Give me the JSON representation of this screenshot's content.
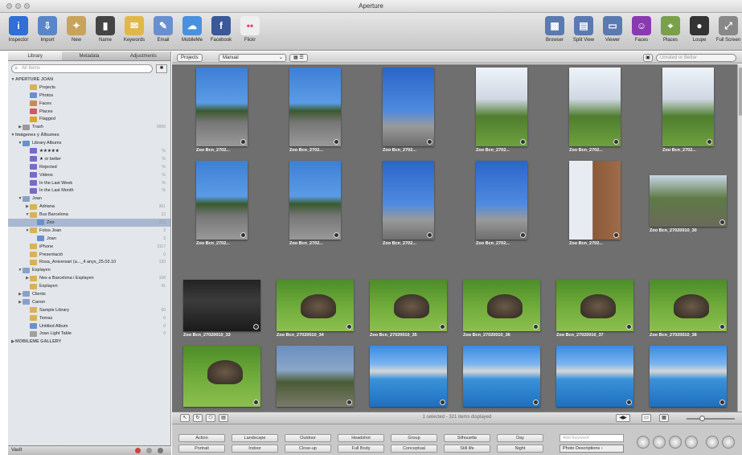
{
  "window": {
    "title": "Aperture"
  },
  "toolbar": {
    "left": [
      {
        "label": "Inspector",
        "icon": "info-icon",
        "color": "#2f6fd6",
        "glyph": "i"
      },
      {
        "label": "Import",
        "icon": "import-arrow-icon",
        "color": "#5a86c8",
        "glyph": "⇩"
      },
      {
        "label": "New",
        "icon": "new-project-icon",
        "color": "#c8a45a",
        "glyph": "✦"
      },
      {
        "label": "Name",
        "icon": "name-stamp-icon",
        "color": "#444444",
        "glyph": "▮"
      },
      {
        "label": "Keywords",
        "icon": "keywords-tag-icon",
        "color": "#e0b84a",
        "glyph": "✉"
      },
      {
        "label": "Email",
        "icon": "email-icon",
        "color": "#6a8fd0",
        "glyph": "✎"
      },
      {
        "label": "MobileMe",
        "icon": "mobileme-cloud-icon",
        "color": "#4a90e0",
        "glyph": "☁"
      },
      {
        "label": "Facebook",
        "icon": "facebook-icon",
        "color": "#3b5998",
        "glyph": "f"
      },
      {
        "label": "Flickr",
        "icon": "flickr-icon",
        "color": "#eeeeee",
        "glyph": "••"
      }
    ],
    "right": [
      {
        "label": "Browser",
        "icon": "browser-view-icon",
        "color": "#5a7ab0",
        "glyph": "▦"
      },
      {
        "label": "Split View",
        "icon": "split-view-icon",
        "color": "#5a7ab0",
        "glyph": "▤"
      },
      {
        "label": "Viewer",
        "icon": "viewer-icon",
        "color": "#5a7ab0",
        "glyph": "▭"
      },
      {
        "label": "Faces",
        "icon": "faces-icon",
        "color": "#8a3ab0",
        "glyph": "☺"
      },
      {
        "label": "Places",
        "icon": "places-icon",
        "color": "#7aa04a",
        "glyph": "⌖"
      },
      {
        "label": "Loupe",
        "icon": "loupe-icon",
        "color": "#333333",
        "glyph": "●"
      },
      {
        "label": "Full Screen",
        "icon": "full-screen-icon",
        "color": "#888888",
        "glyph": "⤢"
      }
    ]
  },
  "sidebar": {
    "tabs": [
      {
        "label": "Library",
        "active": true
      },
      {
        "label": "Metadata",
        "active": false
      },
      {
        "label": "Adjustments",
        "active": false
      }
    ],
    "search_placeholder": "All Items",
    "tree": [
      {
        "label": "APERTURE JOAN",
        "level": 0,
        "kind": "section",
        "tri": "▼",
        "color": "",
        "count": ""
      },
      {
        "label": "Projects",
        "level": 2,
        "kind": "item",
        "tri": "",
        "color": "#d9b15a",
        "count": ""
      },
      {
        "label": "Photos",
        "level": 2,
        "kind": "item",
        "tri": "",
        "color": "#6a8fd0",
        "count": ""
      },
      {
        "label": "Faces",
        "level": 2,
        "kind": "item",
        "tri": "",
        "color": "#c88a5a",
        "count": ""
      },
      {
        "label": "Places",
        "level": 2,
        "kind": "item",
        "tri": "",
        "color": "#d05a5a",
        "count": ""
      },
      {
        "label": "Flagged",
        "level": 2,
        "kind": "item",
        "tri": "",
        "color": "#e0a030",
        "count": ""
      },
      {
        "label": "Trash",
        "level": 1,
        "kind": "item",
        "tri": "▶",
        "color": "#9a9a9a",
        "count": "0000"
      },
      {
        "label": "Imágenes y Álbumes",
        "level": 0,
        "kind": "section",
        "tri": "▼",
        "color": "",
        "count": ""
      },
      {
        "label": "Library Albums",
        "level": 1,
        "kind": "item",
        "tri": "▼",
        "color": "#6a8fd0",
        "count": ""
      },
      {
        "label": "★★★★★",
        "level": 2,
        "kind": "item",
        "tri": "",
        "color": "#7a6ac8",
        "count": "%"
      },
      {
        "label": "★ or better",
        "level": 2,
        "kind": "item",
        "tri": "",
        "color": "#7a6ac8",
        "count": "%"
      },
      {
        "label": "Rejected",
        "level": 2,
        "kind": "item",
        "tri": "",
        "color": "#7a6ac8",
        "count": "%"
      },
      {
        "label": "Videos",
        "level": 2,
        "kind": "item",
        "tri": "",
        "color": "#7a6ac8",
        "count": "%"
      },
      {
        "label": "In the Last Week",
        "level": 2,
        "kind": "item",
        "tri": "",
        "color": "#7a6ac8",
        "count": "%"
      },
      {
        "label": "In the Last Month",
        "level": 2,
        "kind": "item",
        "tri": "",
        "color": "#7a6ac8",
        "count": "%"
      },
      {
        "label": "Joan",
        "level": 1,
        "kind": "item",
        "tri": "▼",
        "color": "#8aa0c8",
        "count": ""
      },
      {
        "label": "Adriana",
        "level": 2,
        "kind": "item",
        "tri": "▶",
        "color": "#d9b15a",
        "count": "361"
      },
      {
        "label": "Bus Barcelona",
        "level": 2,
        "kind": "item",
        "tri": "▼",
        "color": "#d9b15a",
        "count": "13"
      },
      {
        "label": "Zoo",
        "level": 3,
        "kind": "item",
        "tri": "",
        "color": "#6a8fd0",
        "count": "321",
        "selected": true
      },
      {
        "label": "Fotos Joan",
        "level": 2,
        "kind": "item",
        "tri": "▼",
        "color": "#d9b15a",
        "count": "3"
      },
      {
        "label": "Joan",
        "level": 3,
        "kind": "item",
        "tri": "",
        "color": "#6a8fd0",
        "count": "3"
      },
      {
        "label": "iPhone",
        "level": 2,
        "kind": "item",
        "tri": "",
        "color": "#d9b15a",
        "count": "3117"
      },
      {
        "label": "Presentació",
        "level": 2,
        "kind": "item",
        "tri": "",
        "color": "#d9b15a",
        "count": "0"
      },
      {
        "label": "Rosa_Aniversari (a..._4 anys_25.03.10",
        "level": 2,
        "kind": "item",
        "tri": "",
        "color": "#d9b15a",
        "count": "120"
      },
      {
        "label": "Explayen",
        "level": 1,
        "kind": "item",
        "tri": "▼",
        "color": "#8aa0c8",
        "count": ""
      },
      {
        "label": "Nes a Barcelona i Explayen",
        "level": 2,
        "kind": "item",
        "tri": "▶",
        "color": "#d9b15a",
        "count": "108"
      },
      {
        "label": "Explayen",
        "level": 2,
        "kind": "item",
        "tri": "",
        "color": "#d9b15a",
        "count": "41"
      },
      {
        "label": "Clients",
        "level": 1,
        "kind": "item",
        "tri": "▶",
        "color": "#8aa0c8",
        "count": ""
      },
      {
        "label": "Canon",
        "level": 1,
        "kind": "item",
        "tri": "▶",
        "color": "#8aa0c8",
        "count": ""
      },
      {
        "label": "Sample Library",
        "level": 2,
        "kind": "item",
        "tri": "",
        "color": "#d9b15a",
        "count": "60"
      },
      {
        "label": "Temas",
        "level": 2,
        "kind": "item",
        "tri": "",
        "color": "#d9b15a",
        "count": "0"
      },
      {
        "label": "Untitled Album",
        "level": 2,
        "kind": "item",
        "tri": "",
        "color": "#6a8fd0",
        "count": "0"
      },
      {
        "label": "Joan Light Table",
        "level": 2,
        "kind": "item",
        "tri": "",
        "color": "#a0a0a0",
        "count": "0"
      },
      {
        "label": "MOBILEME GALLERY",
        "level": 0,
        "kind": "section",
        "tri": "▶",
        "color": "",
        "count": ""
      }
    ],
    "bottom_label": "Vault"
  },
  "browser_bar": {
    "projects_button": "Projects",
    "sort_select": "Manual",
    "view_toggle": "▦ ☰",
    "filter_placeholder": "Unrated or Better"
  },
  "grid": {
    "photos": [
      {
        "caption": "Zoo Bcn_2702...",
        "style": "p-street",
        "portrait": true
      },
      {
        "caption": "Zoo Bcn_2702...",
        "style": "p-street",
        "portrait": true
      },
      {
        "caption": "Zoo Bcn_2702...",
        "style": "p-tower",
        "portrait": true
      },
      {
        "caption": "Zoo Bcn_2702...",
        "style": "p-palm",
        "portrait": true
      },
      {
        "caption": "Zoo Bcn_2702...",
        "style": "p-palm",
        "portrait": true
      },
      {
        "caption": "Zoo Bcn_2702...",
        "style": "p-palm",
        "portrait": true
      },
      {
        "caption": "Zoo Bcn_2702...",
        "style": "p-street",
        "portrait": true
      },
      {
        "caption": "Zoo Bcn_2702...",
        "style": "p-street",
        "portrait": true
      },
      {
        "caption": "Zoo Bcn_2702...",
        "style": "p-tower",
        "portrait": true
      },
      {
        "caption": "Zoo Bcn_2702...",
        "style": "p-tower",
        "portrait": true
      },
      {
        "caption": "Zoo Bcn_2702...",
        "style": "p-building",
        "portrait": true
      },
      {
        "caption": "Zoo Bcn_27020010_30",
        "style": "p-park",
        "portrait": false
      },
      {
        "caption": "Zoo Bcn_27020010_33",
        "style": "p-dark",
        "portrait": false
      },
      {
        "caption": "Zoo Bcn_27020010_34",
        "style": "p-grass",
        "portrait": false,
        "turtle": true
      },
      {
        "caption": "Zoo Bcn_27020010_35",
        "style": "p-grass",
        "portrait": false,
        "turtle": true
      },
      {
        "caption": "Zoo Bcn_27020010_36",
        "style": "p-grass",
        "portrait": false,
        "turtle": true
      },
      {
        "caption": "Zoo Bcn_27020010_37",
        "style": "p-grass",
        "portrait": false,
        "turtle": true
      },
      {
        "caption": "Zoo Bcn_27020010_38",
        "style": "p-grass",
        "portrait": false,
        "turtle": true
      },
      {
        "caption": "",
        "style": "p-grass",
        "portrait": false,
        "turtle": true
      },
      {
        "caption": "",
        "style": "p-trees",
        "portrait": false
      },
      {
        "caption": "",
        "style": "p-pool",
        "portrait": false
      },
      {
        "caption": "",
        "style": "p-pool",
        "portrait": false
      },
      {
        "caption": "",
        "style": "p-pool",
        "portrait": false
      },
      {
        "caption": "",
        "style": "p-pool",
        "portrait": false
      }
    ]
  },
  "status": {
    "text": "1 selected - 321 items displayed"
  },
  "keywords": {
    "row1": [
      "Action",
      "Landscape",
      "Outdoor",
      "Headshot",
      "Group",
      "Silhouette",
      "Day"
    ],
    "row2": [
      "Portrait",
      "Indoor",
      "Close-up",
      "Full Body",
      "Conceptual",
      "Still life",
      "Night"
    ],
    "field_placeholder": "Add Keyword",
    "preset_select": "Photo Descriptions ›"
  }
}
